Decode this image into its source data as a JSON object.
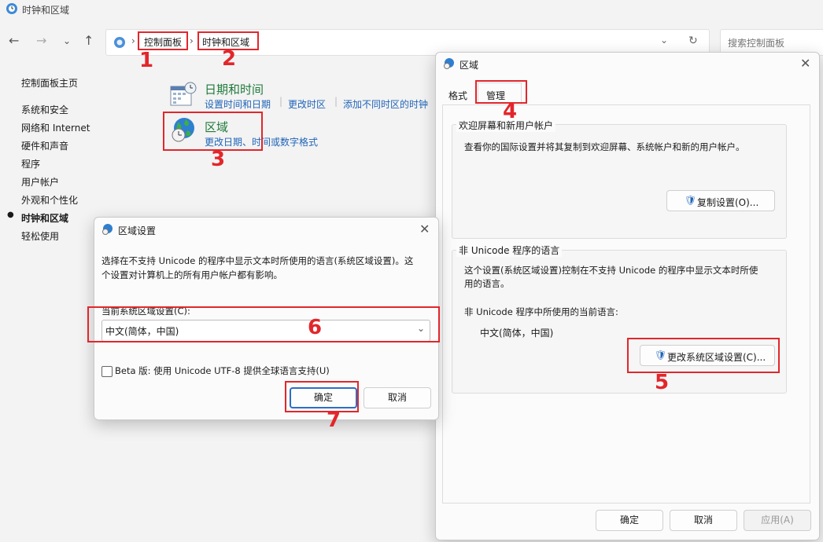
{
  "window": {
    "title": "时钟和区域"
  },
  "address": {
    "crumb1": "控制面板",
    "crumb2": "时钟和区域",
    "search_placeholder": "搜索控制面板"
  },
  "sidebar": {
    "items": [
      {
        "label": "控制面板主页"
      },
      {
        "label": "系统和安全"
      },
      {
        "label": "网络和 Internet"
      },
      {
        "label": "硬件和声音"
      },
      {
        "label": "程序"
      },
      {
        "label": "用户帐户"
      },
      {
        "label": "外观和个性化"
      },
      {
        "label": "时钟和区域"
      },
      {
        "label": "轻松使用"
      }
    ]
  },
  "main": {
    "datetime": {
      "title": "日期和时间",
      "link1": "设置时间和日期",
      "link2": "更改时区",
      "link3": "添加不同时区的时钟"
    },
    "region": {
      "title": "区域",
      "link1": "更改日期、时间或数字格式"
    }
  },
  "region_dialog": {
    "title": "区域",
    "tabs": [
      "格式",
      "管理"
    ],
    "welcome": {
      "title": "欢迎屏幕和新用户帐户",
      "desc": "查看你的国际设置并将其复制到欢迎屏幕、系统帐户和新的用户帐户。",
      "button": "复制设置(O)..."
    },
    "nonunicode": {
      "title": "非 Unicode 程序的语言",
      "desc1": "这个设置(系统区域设置)控制在不支持 Unicode 的程序中显示文本时所使",
      "desc2": "用的语言。",
      "current_label": "非 Unicode 程序中所使用的当前语言:",
      "current_value": "中文(简体，中国)",
      "button": "更改系统区域设置(C)..."
    },
    "ok": "确定",
    "cancel": "取消",
    "apply": "应用(A)"
  },
  "locale_dialog": {
    "title": "区域设置",
    "desc1": "选择在不支持 Unicode 的程序中显示文本时所使用的语言(系统区域设置)。这",
    "desc2": "个设置对计算机上的所有用户帐户都有影响。",
    "current_label": "当前系统区域设置(C):",
    "current_value": "中文(简体，中国)",
    "beta_label": "Beta 版: 使用 Unicode UTF-8 提供全球语言支持(U)",
    "beta_checked": false,
    "ok": "确定",
    "cancel": "取消"
  },
  "annotations": [
    "1",
    "2",
    "3",
    "4",
    "5",
    "6",
    "7"
  ],
  "colors": {
    "annotation": "#e2262b",
    "link": "#1f64b8",
    "heading": "#1f7a3a"
  }
}
